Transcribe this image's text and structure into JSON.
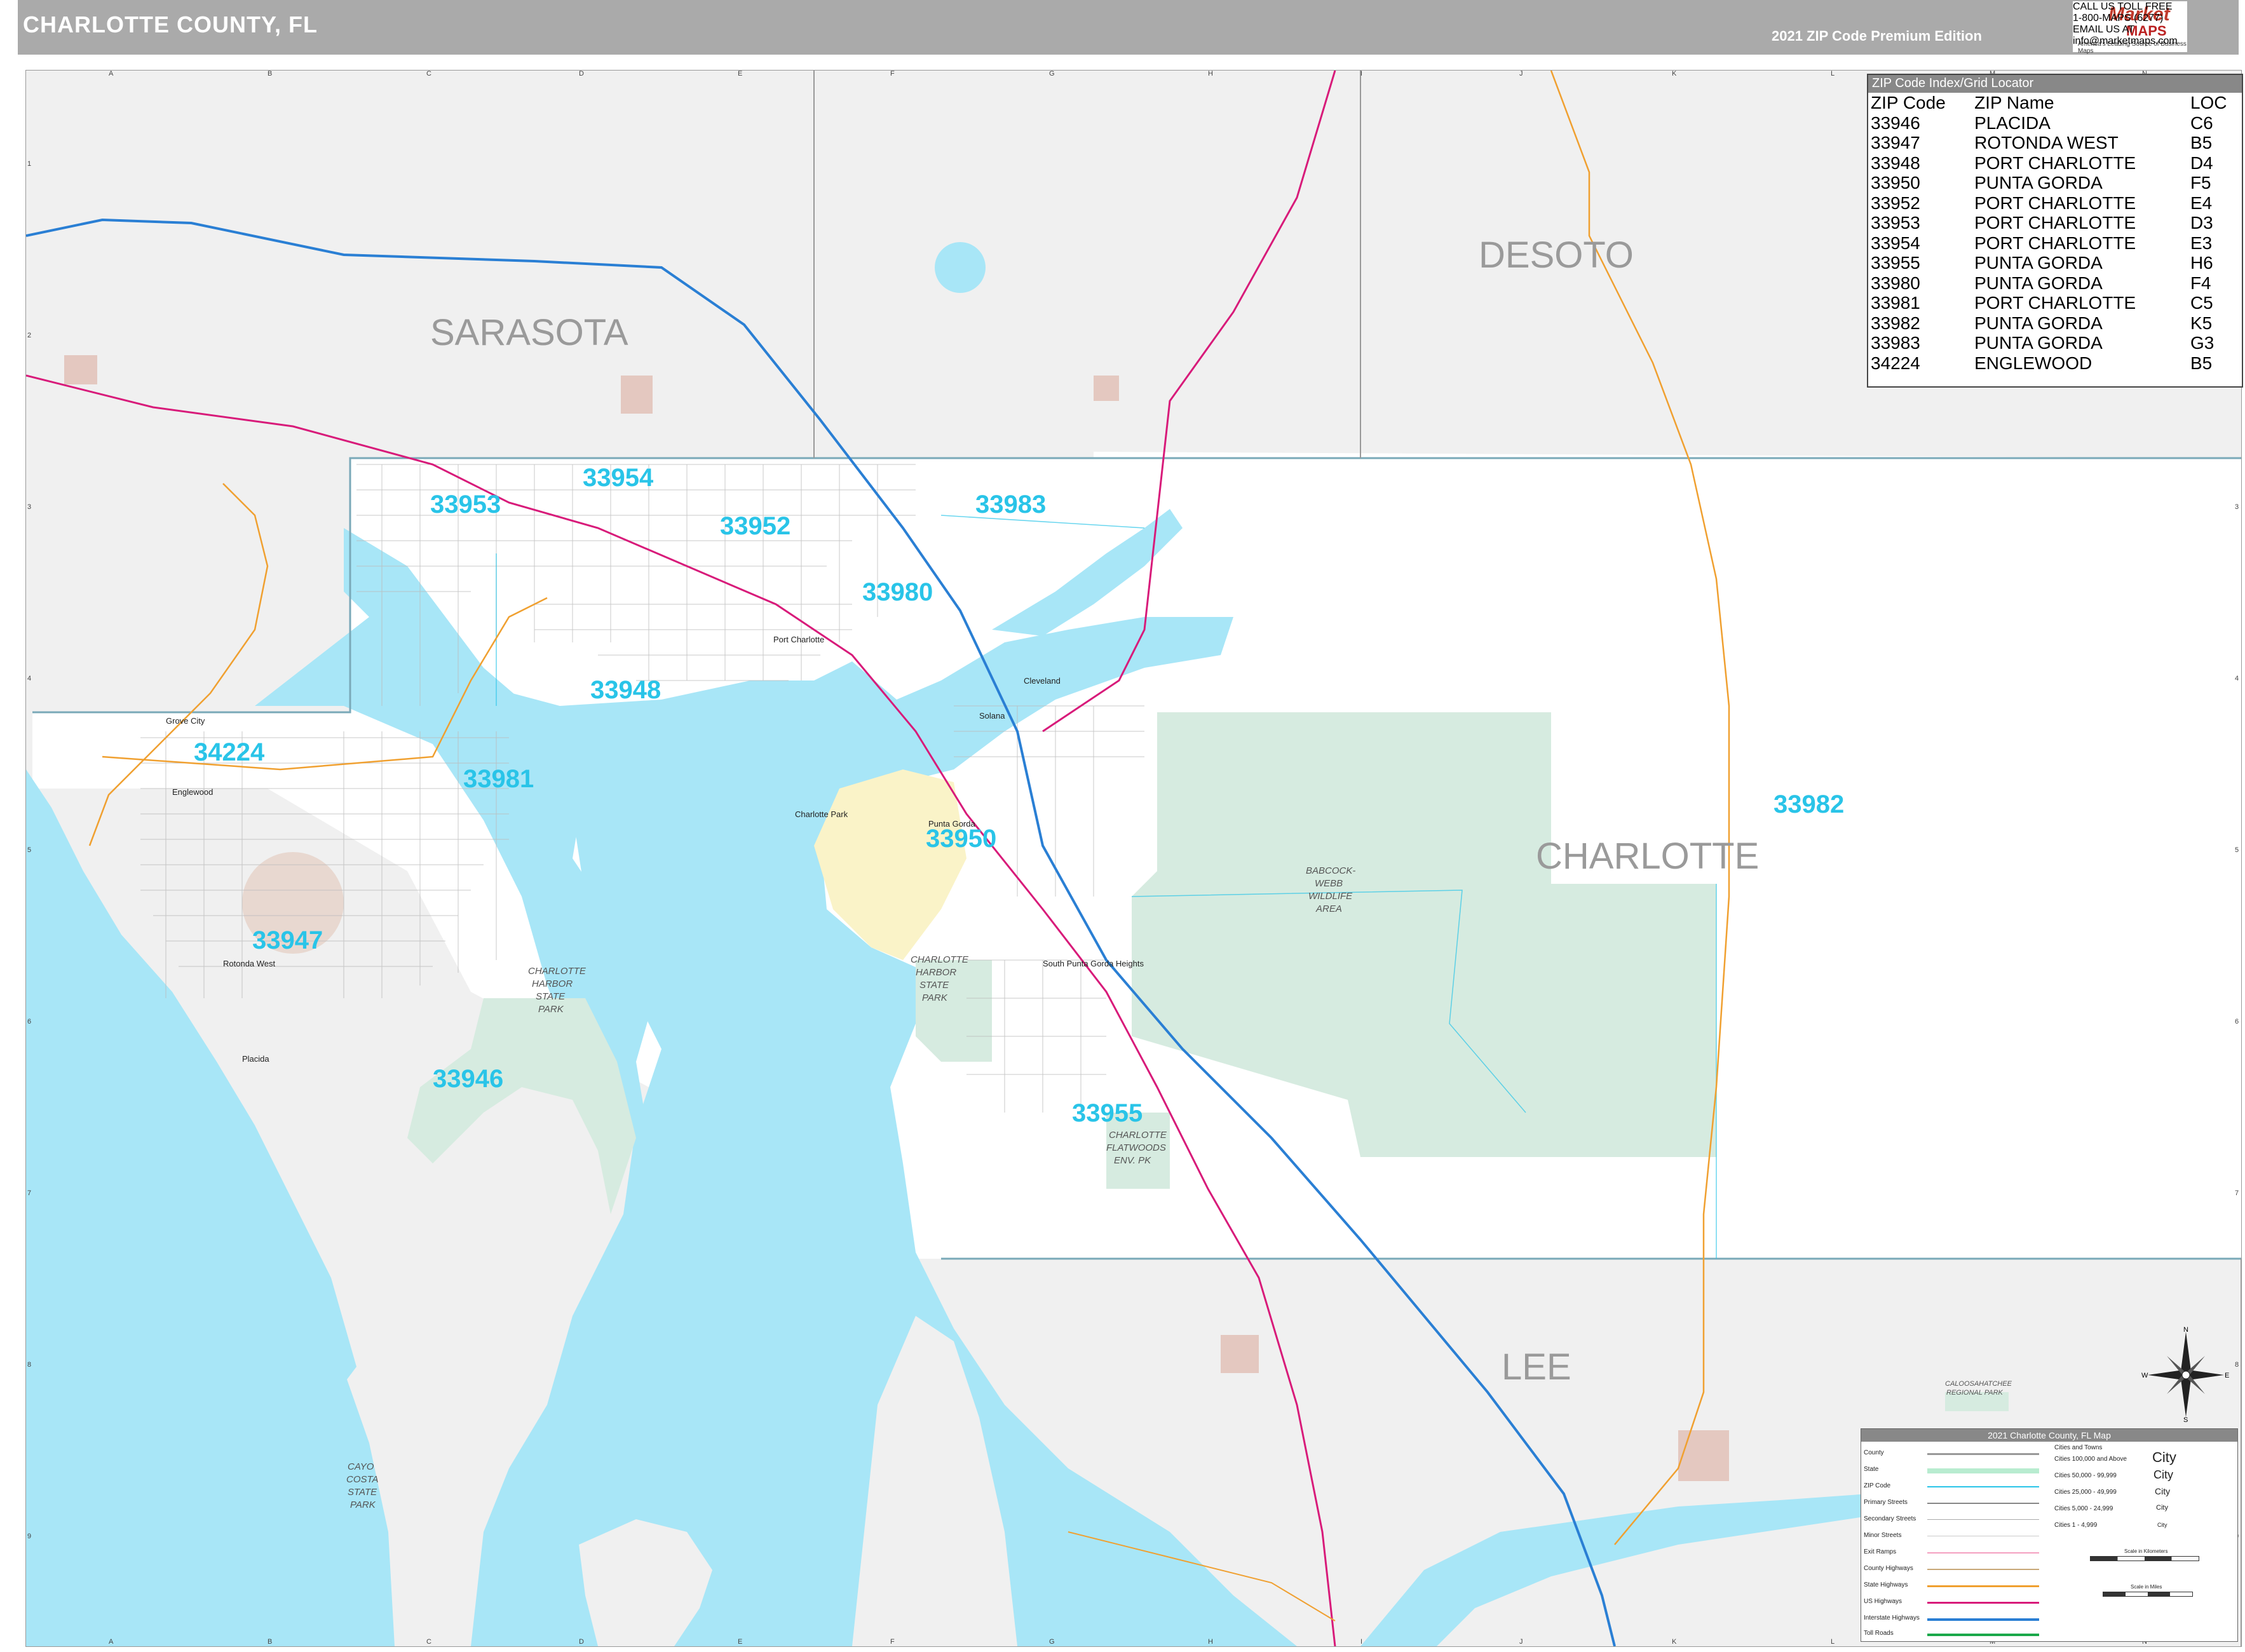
{
  "header": {
    "title": "CHARLOTTE COUNTY, FL",
    "edition": "2021 ZIP Code Premium Edition"
  },
  "logo": {
    "brand": "Market",
    "brand2": "MAPS",
    "tagline": "America's Leading Source of Business Maps",
    "contact": [
      "CALL US TOLL FREE",
      "1-800-MAPS (6277)",
      "EMAIL US AT",
      "info@marketmaps.com"
    ]
  },
  "counties": [
    "SARASOTA",
    "DESOTO",
    "CHARLOTTE",
    "LEE"
  ],
  "zip_labels": [
    "33954",
    "33953",
    "33952",
    "33983",
    "33980",
    "33948",
    "34224",
    "33981",
    "33950",
    "33947",
    "33946",
    "33955",
    "33982"
  ],
  "parks": [
    [
      "CHARLOTTE",
      "HARBOR",
      "STATE",
      "PARK"
    ],
    [
      "CHARLOTTE",
      "HARBOR",
      "STATE",
      "PARK"
    ],
    [
      "BABCOCK-",
      "WEBB",
      "WILDLIFE",
      "AREA"
    ],
    [
      "CHARLOTTE",
      "FLATWOODS",
      "ENV. PK"
    ],
    [
      "CAYO",
      "COSTA",
      "STATE",
      "PARK"
    ],
    [
      "CALOOSAHATCHEE",
      "REGIONAL PARK"
    ]
  ],
  "cities": [
    "Port Charlotte",
    "Punta Gorda",
    "Englewood",
    "Rotonda West",
    "Placida",
    "Cleveland",
    "Solana",
    "South Punta Gorda Heights",
    "Charlotte Park",
    "Grove City"
  ],
  "grid_letters": [
    "A",
    "B",
    "C",
    "D",
    "E",
    "F",
    "G",
    "H",
    "I",
    "J",
    "K",
    "L",
    "M",
    "N"
  ],
  "grid_numbers": [
    "1",
    "2",
    "3",
    "4",
    "5",
    "6",
    "7",
    "8",
    "9"
  ],
  "zip_index": {
    "title": "ZIP Code Index/Grid Locator",
    "columns": [
      "ZIP Code",
      "ZIP Name",
      "LOC"
    ],
    "rows": [
      [
        "33946",
        "PLACIDA",
        "C6"
      ],
      [
        "33947",
        "ROTONDA WEST",
        "B5"
      ],
      [
        "33948",
        "PORT CHARLOTTE",
        "D4"
      ],
      [
        "33950",
        "PUNTA GORDA",
        "F5"
      ],
      [
        "33952",
        "PORT CHARLOTTE",
        "E4"
      ],
      [
        "33953",
        "PORT CHARLOTTE",
        "D3"
      ],
      [
        "33954",
        "PORT CHARLOTTE",
        "E3"
      ],
      [
        "33955",
        "PUNTA GORDA",
        "H6"
      ],
      [
        "33980",
        "PUNTA GORDA",
        "F4"
      ],
      [
        "33981",
        "PORT CHARLOTTE",
        "C5"
      ],
      [
        "33982",
        "PUNTA GORDA",
        "K5"
      ],
      [
        "33983",
        "PUNTA GORDA",
        "G3"
      ],
      [
        "34224",
        "ENGLEWOOD",
        "B5"
      ]
    ]
  },
  "legend": {
    "title": "2021 Charlotte County, FL Map",
    "items": [
      "County",
      "State",
      "ZIP Code",
      "Primary Streets",
      "Secondary Streets",
      "Minor Streets",
      "Exit Ramps",
      "County Highways",
      "State Highways",
      "US Highways",
      "Interstate Highways",
      "Toll Roads"
    ],
    "cities_header": "Cities and Towns",
    "cities": [
      [
        "Cities 100,000 and Above",
        "City"
      ],
      [
        "Cities 50,000 - 99,999",
        "City"
      ],
      [
        "Cities 25,000 - 49,999",
        "City"
      ],
      [
        "Cities 5,000 - 24,999",
        "City"
      ],
      [
        "Cities 1 - 4,999",
        "City"
      ]
    ],
    "scale_km": "Scale in Kilometers",
    "scale_mi": "Scale in Miles"
  },
  "compass": {
    "n": "N",
    "s": "S",
    "e": "E",
    "w": "W"
  },
  "colors": {
    "water": "#a8e6f7",
    "land_outside": "#f0f0f0",
    "county_land": "#ffffff",
    "park": "#d6ebe0",
    "zip_label": "#29c4e8",
    "interstate": "#2a7fd4",
    "us_highway": "#d81b7a",
    "state_highway": "#f0a030"
  }
}
